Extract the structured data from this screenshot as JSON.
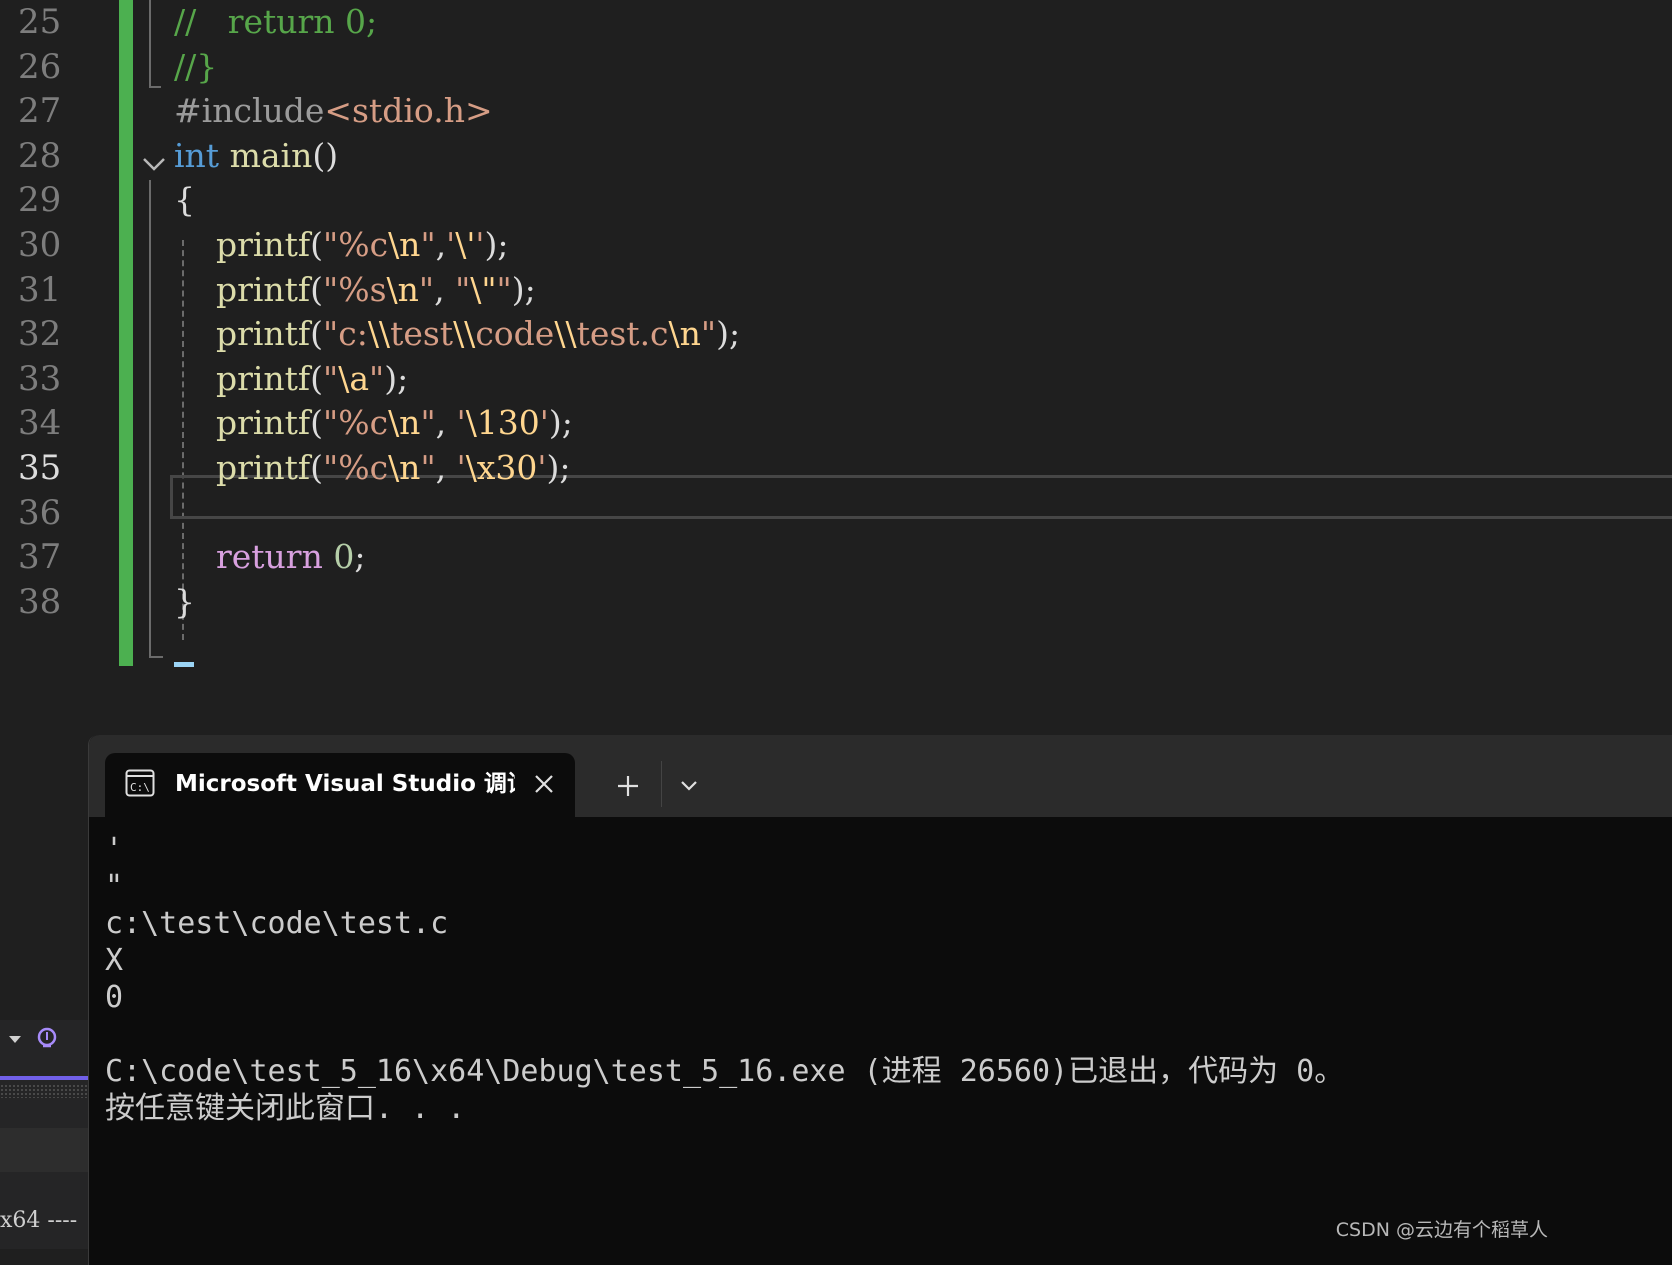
{
  "editor": {
    "line_numbers": [
      "25",
      "26",
      "27",
      "28",
      "29",
      "30",
      "31",
      "32",
      "33",
      "34",
      "35",
      "36",
      "37",
      "38"
    ],
    "current_line": "35",
    "lines": [
      [
        {
          "t": "//   return 0;",
          "c": "cmt"
        }
      ],
      [
        {
          "t": "//}",
          "c": "cmt"
        }
      ],
      [
        {
          "t": "#include",
          "c": "pp"
        },
        {
          "t": "<stdio.h>",
          "c": "str"
        }
      ],
      [
        {
          "t": "int",
          "c": "kw"
        },
        {
          "t": " ",
          "c": "punc"
        },
        {
          "t": "main",
          "c": "fn"
        },
        {
          "t": "()",
          "c": "punc"
        }
      ],
      [
        {
          "t": "{",
          "c": "punc"
        }
      ],
      [
        {
          "t": "    ",
          "c": "punc"
        },
        {
          "t": "printf",
          "c": "fn"
        },
        {
          "t": "(",
          "c": "punc"
        },
        {
          "t": "\"%c",
          "c": "str"
        },
        {
          "t": "\\n",
          "c": "esc"
        },
        {
          "t": "\"",
          "c": "str"
        },
        {
          "t": ",",
          "c": "punc"
        },
        {
          "t": "'",
          "c": "str"
        },
        {
          "t": "\\'",
          "c": "esc"
        },
        {
          "t": "'",
          "c": "str"
        },
        {
          "t": ");",
          "c": "punc"
        }
      ],
      [
        {
          "t": "    ",
          "c": "punc"
        },
        {
          "t": "printf",
          "c": "fn"
        },
        {
          "t": "(",
          "c": "punc"
        },
        {
          "t": "\"%s",
          "c": "str"
        },
        {
          "t": "\\n",
          "c": "esc"
        },
        {
          "t": "\"",
          "c": "str"
        },
        {
          "t": ", ",
          "c": "punc"
        },
        {
          "t": "\"",
          "c": "str"
        },
        {
          "t": "\\\"",
          "c": "esc"
        },
        {
          "t": "\"",
          "c": "str"
        },
        {
          "t": ");",
          "c": "punc"
        }
      ],
      [
        {
          "t": "    ",
          "c": "punc"
        },
        {
          "t": "printf",
          "c": "fn"
        },
        {
          "t": "(",
          "c": "punc"
        },
        {
          "t": "\"c:",
          "c": "str"
        },
        {
          "t": "\\\\",
          "c": "esc"
        },
        {
          "t": "test",
          "c": "str"
        },
        {
          "t": "\\\\",
          "c": "esc"
        },
        {
          "t": "code",
          "c": "str"
        },
        {
          "t": "\\\\",
          "c": "esc"
        },
        {
          "t": "test.c",
          "c": "str"
        },
        {
          "t": "\\n",
          "c": "esc"
        },
        {
          "t": "\"",
          "c": "str"
        },
        {
          "t": ");",
          "c": "punc"
        }
      ],
      [
        {
          "t": "    ",
          "c": "punc"
        },
        {
          "t": "printf",
          "c": "fn"
        },
        {
          "t": "(",
          "c": "punc"
        },
        {
          "t": "\"",
          "c": "str"
        },
        {
          "t": "\\a",
          "c": "esc"
        },
        {
          "t": "\"",
          "c": "str"
        },
        {
          "t": ");",
          "c": "punc"
        }
      ],
      [
        {
          "t": "    ",
          "c": "punc"
        },
        {
          "t": "printf",
          "c": "fn"
        },
        {
          "t": "(",
          "c": "punc"
        },
        {
          "t": "\"%c",
          "c": "str"
        },
        {
          "t": "\\n",
          "c": "esc"
        },
        {
          "t": "\"",
          "c": "str"
        },
        {
          "t": ", ",
          "c": "punc"
        },
        {
          "t": "'",
          "c": "str"
        },
        {
          "t": "\\130",
          "c": "esc"
        },
        {
          "t": "'",
          "c": "str"
        },
        {
          "t": ");",
          "c": "punc"
        }
      ],
      [
        {
          "t": "    ",
          "c": "punc"
        },
        {
          "t": "printf",
          "c": "fn"
        },
        {
          "t": "(",
          "c": "punc"
        },
        {
          "t": "\"%c",
          "c": "str"
        },
        {
          "t": "\\n",
          "c": "esc"
        },
        {
          "t": "\"",
          "c": "str"
        },
        {
          "t": ", ",
          "c": "punc"
        },
        {
          "t": "'",
          "c": "str"
        },
        {
          "t": "\\x30",
          "c": "esc"
        },
        {
          "t": "'",
          "c": "str"
        },
        {
          "t": ");",
          "c": "punc"
        }
      ],
      [
        {
          "t": "",
          "c": "punc"
        }
      ],
      [
        {
          "t": "    ",
          "c": "punc"
        },
        {
          "t": "return",
          "c": "ret"
        },
        {
          "t": " ",
          "c": "punc"
        },
        {
          "t": "0",
          "c": "num"
        },
        {
          "t": ";",
          "c": "punc"
        }
      ],
      [
        {
          "t": "}",
          "c": "punc"
        }
      ]
    ]
  },
  "left_strip": {
    "platform_label": "x64 ----"
  },
  "terminal": {
    "tab_title": "Microsoft Visual Studio 调试控制台",
    "output_lines": [
      "'",
      "\"",
      "c:\\test\\code\\test.c",
      "X",
      "0",
      "",
      "C:\\code\\test_5_16\\x64\\Debug\\test_5_16.exe (进程 26560)已退出，代码为 0。",
      "按任意键关闭此窗口. . ."
    ]
  },
  "watermark": "CSDN @云边有个稻草人",
  "colors": {
    "change_bar": "#4cb050",
    "keyword": "#569cd6",
    "comment": "#57a64a",
    "string": "#d69d85",
    "function": "#dcdcaa",
    "return_keyword": "#d8a0df"
  }
}
